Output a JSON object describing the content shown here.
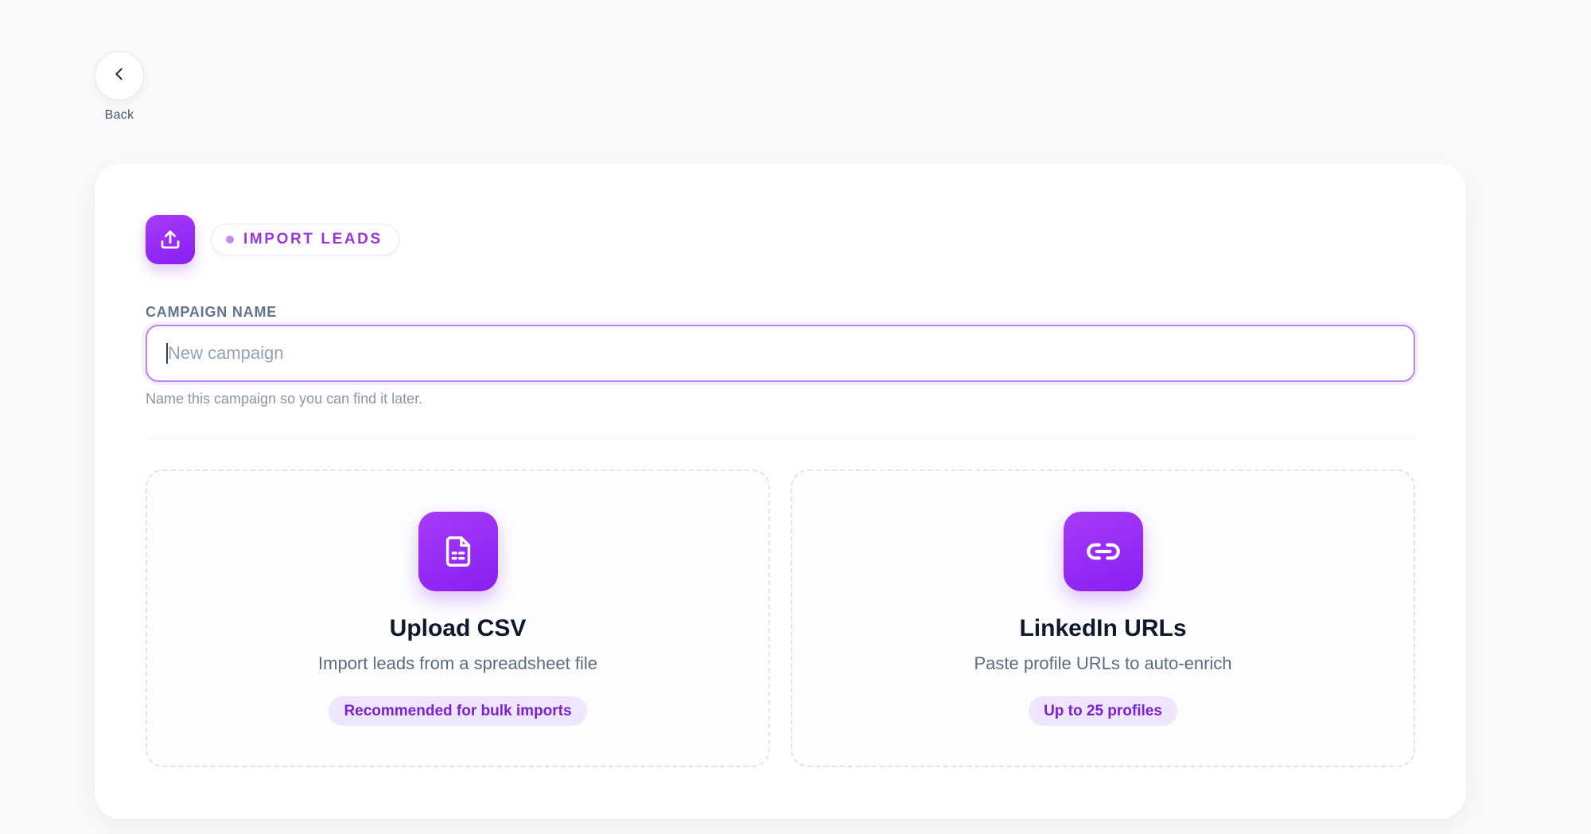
{
  "back": {
    "label": "Back",
    "icon": "chevron-left-icon"
  },
  "header": {
    "icon": "upload-icon",
    "badge": "IMPORT LEADS"
  },
  "campaign": {
    "label": "CAMPAIGN NAME",
    "value": "",
    "placeholder": "New campaign",
    "hint": "Name this campaign so you can find it later."
  },
  "options": [
    {
      "icon": "file-document-icon",
      "title": "Upload CSV",
      "description": "Import leads from a spreadsheet file",
      "badge": "Recommended for bulk imports"
    },
    {
      "icon": "link-icon",
      "title": "LinkedIn URLs",
      "description": "Paste profile URLs to auto-enrich",
      "badge": "Up to 25 profiles"
    }
  ],
  "colors": {
    "accent": "#9333ea",
    "accent_light": "#efe6fc",
    "background": "#f8fafc"
  }
}
